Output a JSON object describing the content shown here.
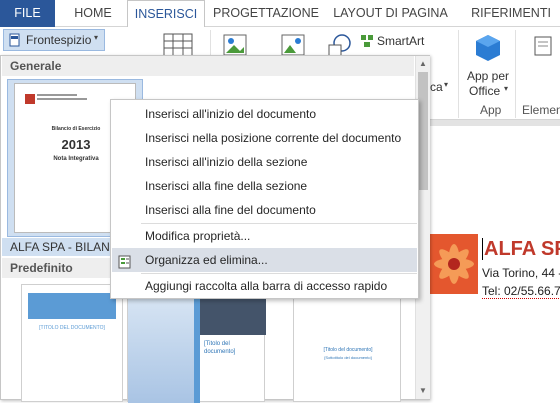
{
  "tabs": {
    "file": "FILE",
    "home": "HOME",
    "insert": "INSERISCI",
    "design": "PROGETTAZIONE",
    "layout": "LAYOUT DI PAGINA",
    "references": "RIFERIMENTI"
  },
  "ribbon": {
    "cover_page_button": "Frontespizio",
    "smartart": "SmartArt",
    "apps_for_office_line1": "App per",
    "apps_for_office_line2": "Office",
    "group_app": "App",
    "group_elements": "Element",
    "partial_label": "ca"
  },
  "gallery": {
    "section_general": "Generale",
    "section_default": "Predefinito",
    "custom_thumb_caption": "ALFA SPA - BILANC",
    "custom_thumb": {
      "line1": "Bilancio di Esercizio",
      "year": "2013",
      "subtitle": "Nota Integrativa"
    },
    "thumb1_title": "[TITOLO DEL DOCUMENTO]",
    "thumb2_title_l1": "[Titolo del",
    "thumb2_title_l2": "documento]",
    "thumb3_title": "[Titolo del documento]",
    "thumb3_sub": "[Sottotitolo del documento]"
  },
  "context_menu": {
    "items": [
      "Inserisci all'inizio del documento",
      "Inserisci nella posizione corrente del documento",
      "Inserisci all'inizio della sezione",
      "Inserisci alla fine della sezione",
      "Inserisci alla fine del documento",
      "Modifica proprietà...",
      "Organizza ed elimina...",
      "Aggiungi raccolta alla barra di accesso rapido"
    ]
  },
  "document": {
    "company": "ALFA SPA",
    "address": "Via Torino, 44 -",
    "phone": "Tel: 02/55.66.7"
  },
  "colors": {
    "file_tab": "#2b579a",
    "accent_text": "#c0392b",
    "menu_highlight": "#dadfe7"
  }
}
